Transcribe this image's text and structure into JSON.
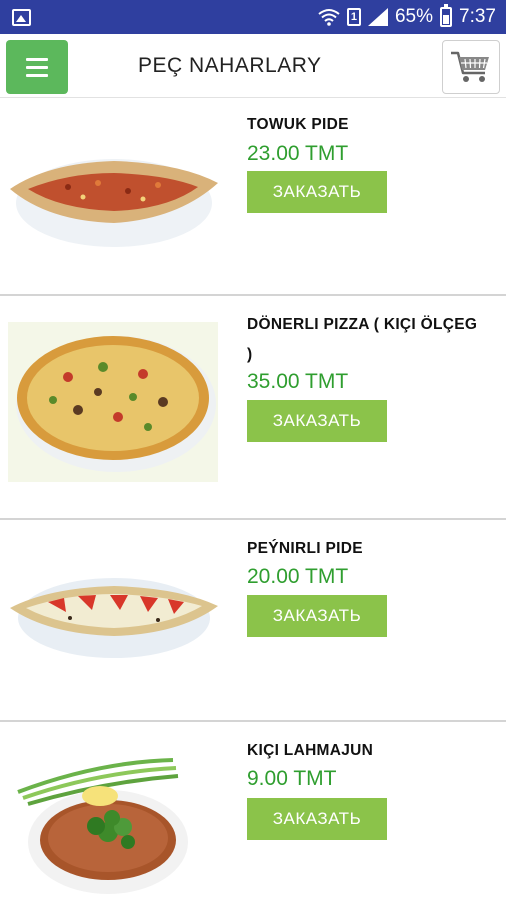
{
  "status_bar": {
    "battery": "65%",
    "time": "7:37",
    "sim": "1"
  },
  "app_bar": {
    "title": "PEÇ NAHARLARY"
  },
  "products": [
    {
      "name": "TOWUK PIDE",
      "price": "23.00 TMT",
      "order_label": "ЗАКАЗАТЬ"
    },
    {
      "name": "DÖNERLI PIZZA ( KIÇI ÖLÇEG )",
      "price": "35.00 TMT",
      "order_label": "ЗАКАЗАТЬ"
    },
    {
      "name": "PEÝNIRLI PIDE",
      "price": "20.00 TMT",
      "order_label": "ЗАКАЗАТЬ"
    },
    {
      "name": "KIÇI LAHMAJUN",
      "price": "9.00 TMT",
      "order_label": "ЗАКАЗАТЬ"
    }
  ],
  "colors": {
    "status_bar": "#2f3f9f",
    "menu_button": "#5cb85c",
    "order_button": "#8bc34a",
    "price_text": "#2f9e2f"
  },
  "icons": {
    "menu": "hamburger-icon",
    "cart": "shopping-cart-icon",
    "gallery": "gallery-icon",
    "wifi": "wifi-icon",
    "signal": "signal-icon",
    "battery": "battery-icon"
  }
}
